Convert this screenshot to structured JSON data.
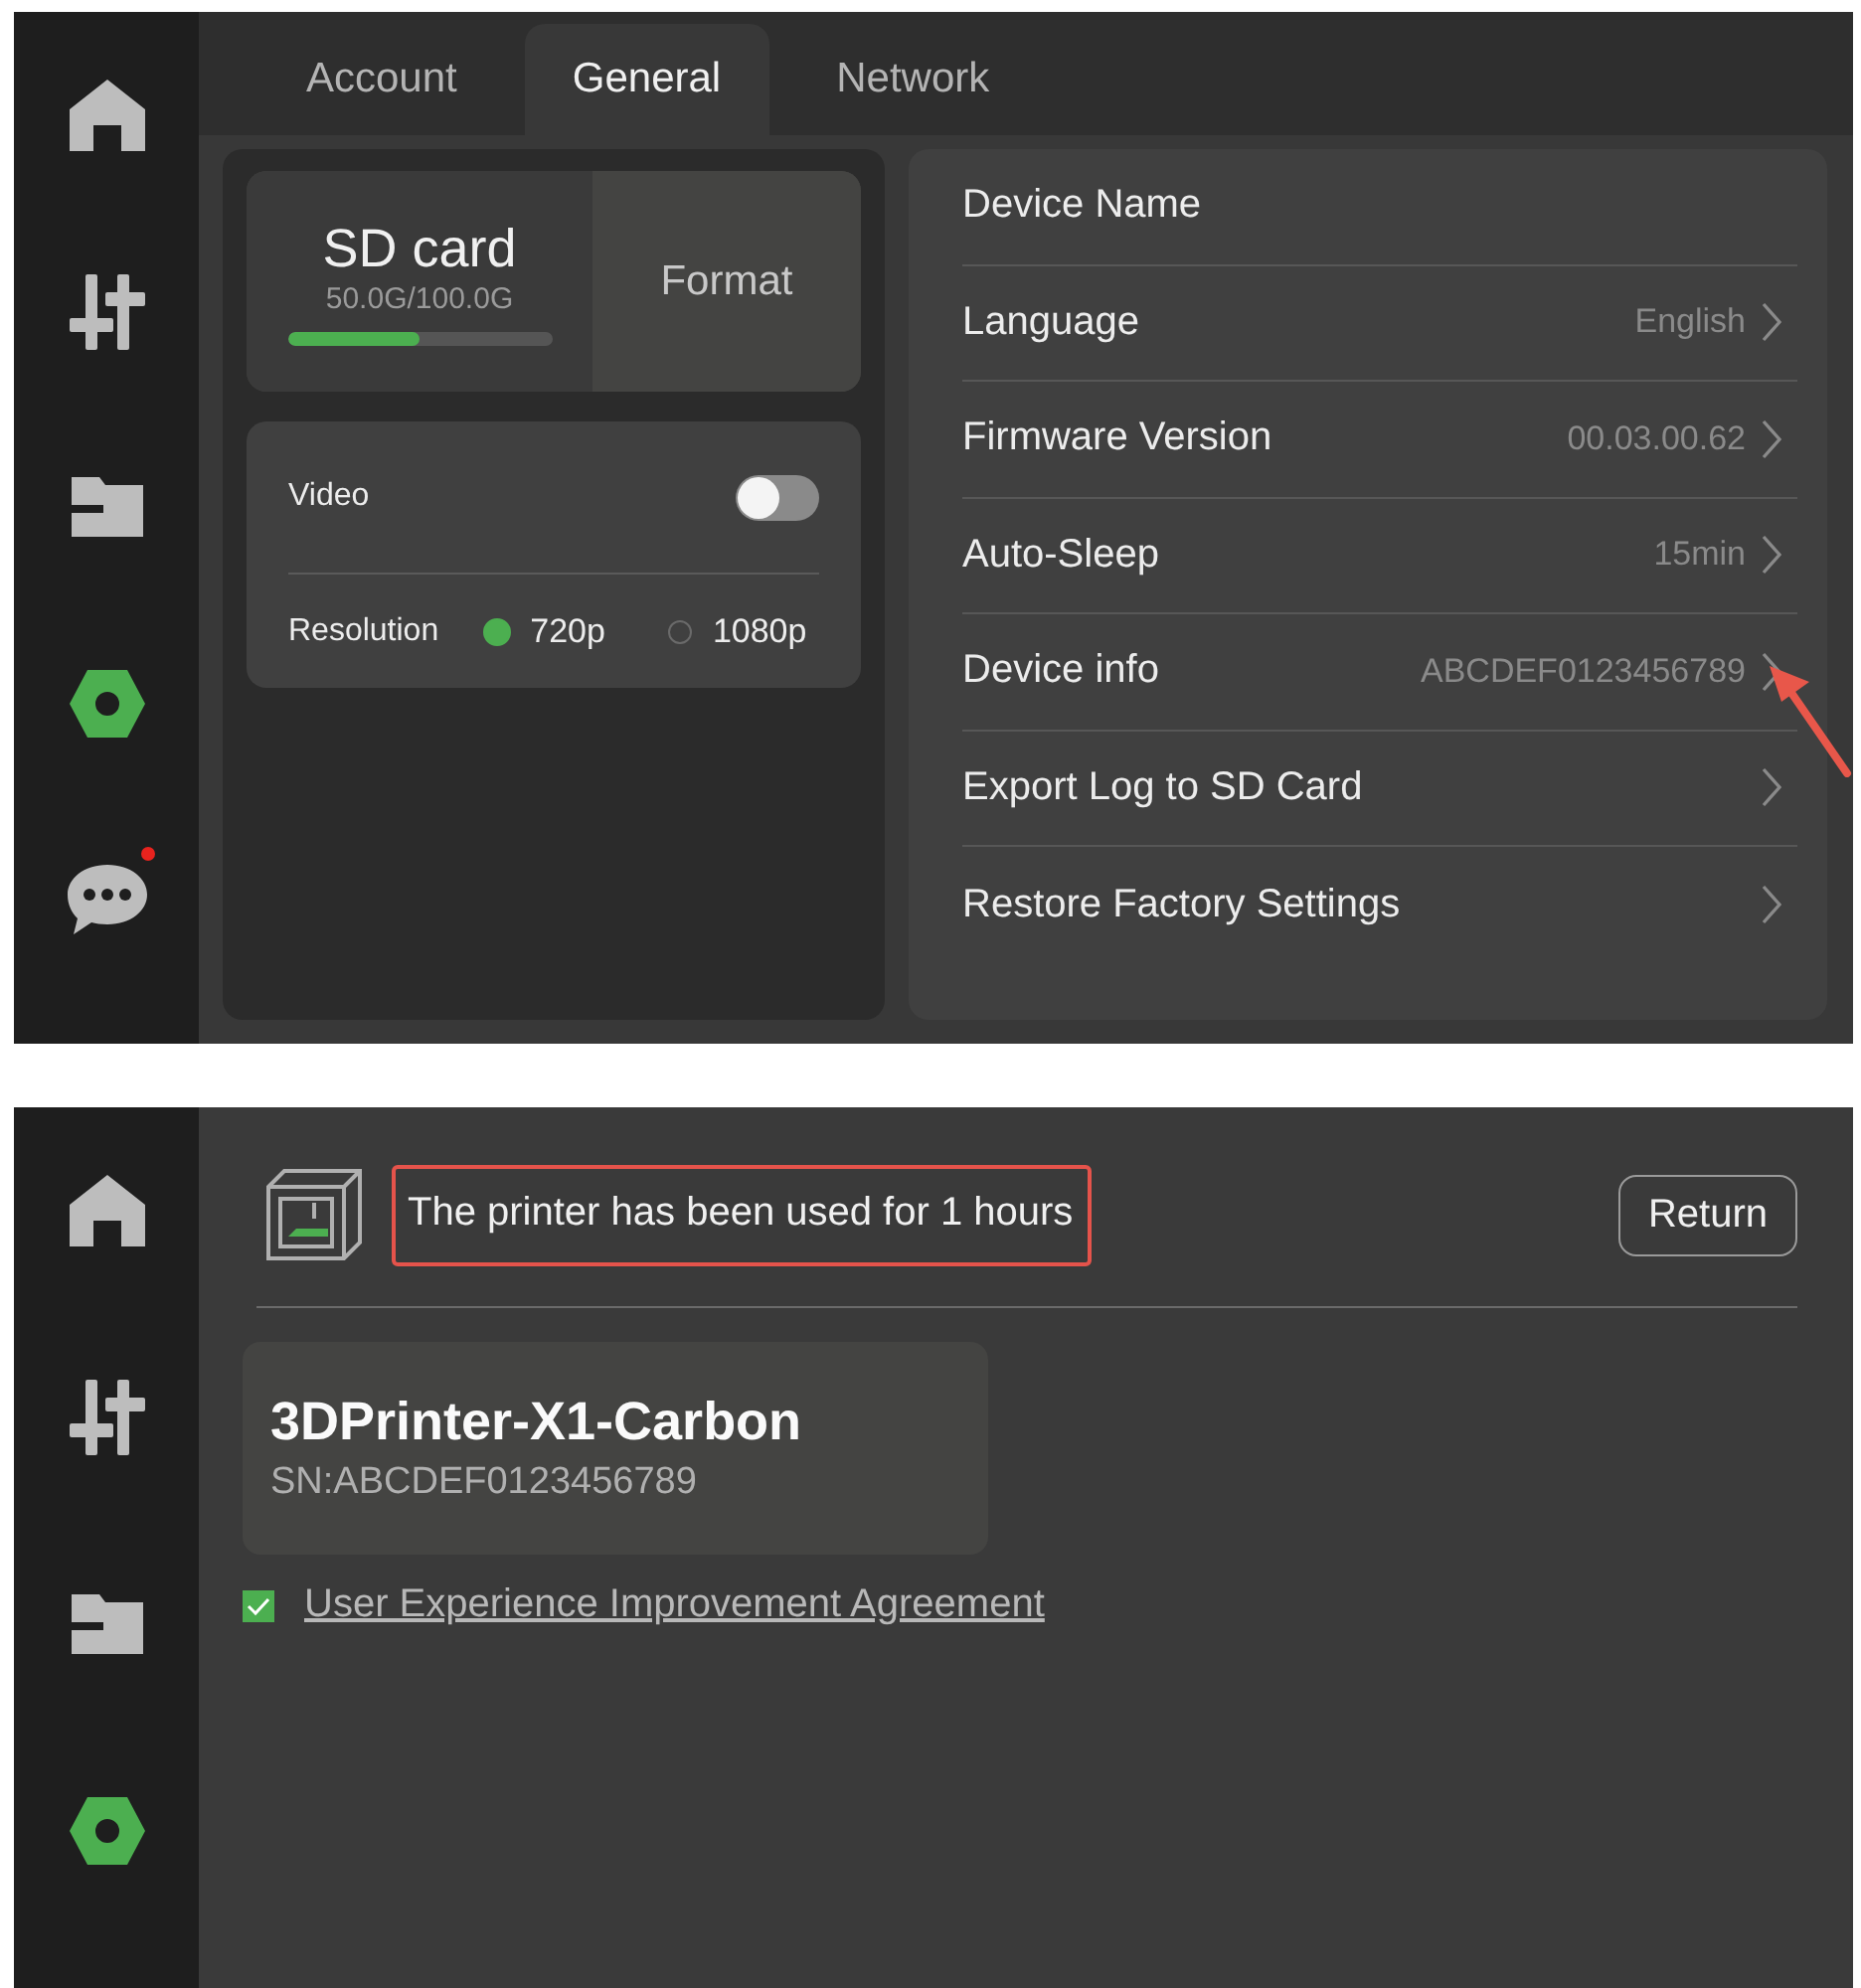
{
  "top_screen": {
    "sidebar": [
      {
        "kind": "home",
        "selected": false,
        "unread": false
      },
      {
        "kind": "controls",
        "selected": false,
        "unread": false
      },
      {
        "kind": "files",
        "selected": false,
        "unread": false
      },
      {
        "kind": "settings",
        "selected": true,
        "unread": false
      },
      {
        "kind": "messages",
        "selected": false,
        "unread": true
      }
    ],
    "tabs": [
      {
        "label": "Account",
        "selected": false
      },
      {
        "label": "General",
        "selected": true
      },
      {
        "label": "Network",
        "selected": false
      }
    ],
    "sd_card": {
      "title": "SD card",
      "usage": "50.0G/100.0G",
      "level": 0.5,
      "format_button": "Format"
    },
    "video": {
      "label": "Video",
      "on": false,
      "resolution_label": "Resolution",
      "options": [
        {
          "label": "720p",
          "selected": true
        },
        {
          "label": "1080p",
          "selected": false
        }
      ]
    },
    "settings": [
      {
        "label": "Device Name",
        "chevron": false
      },
      {
        "label": "Language",
        "value": "English",
        "chevron": true
      },
      {
        "label": "Firmware Version",
        "value": "00.03.00.62",
        "chevron": true
      },
      {
        "label": "Auto-Sleep",
        "value": "15min",
        "chevron": true
      },
      {
        "label": "Device info",
        "value": "ABCDEF0123456789",
        "chevron": true
      },
      {
        "label": "Export Log to SD Card",
        "chevron": true
      },
      {
        "label": "Restore Factory Settings",
        "chevron": true
      }
    ]
  },
  "bottom_screen": {
    "sidebar": [
      {
        "kind": "home",
        "selected": false,
        "unread": false
      },
      {
        "kind": "controls",
        "selected": false,
        "unread": false
      },
      {
        "kind": "files",
        "selected": false,
        "unread": false
      },
      {
        "kind": "settings",
        "selected": true,
        "unread": false
      }
    ],
    "usage_message": "The printer has been used for 1 hours",
    "return_button": "Return",
    "device": {
      "name": "3DPrinter-X1-Carbon",
      "serial": "SN:ABCDEF0123456789"
    },
    "agreement": {
      "label": "User Experience Improvement Agreement",
      "checked": true
    }
  }
}
